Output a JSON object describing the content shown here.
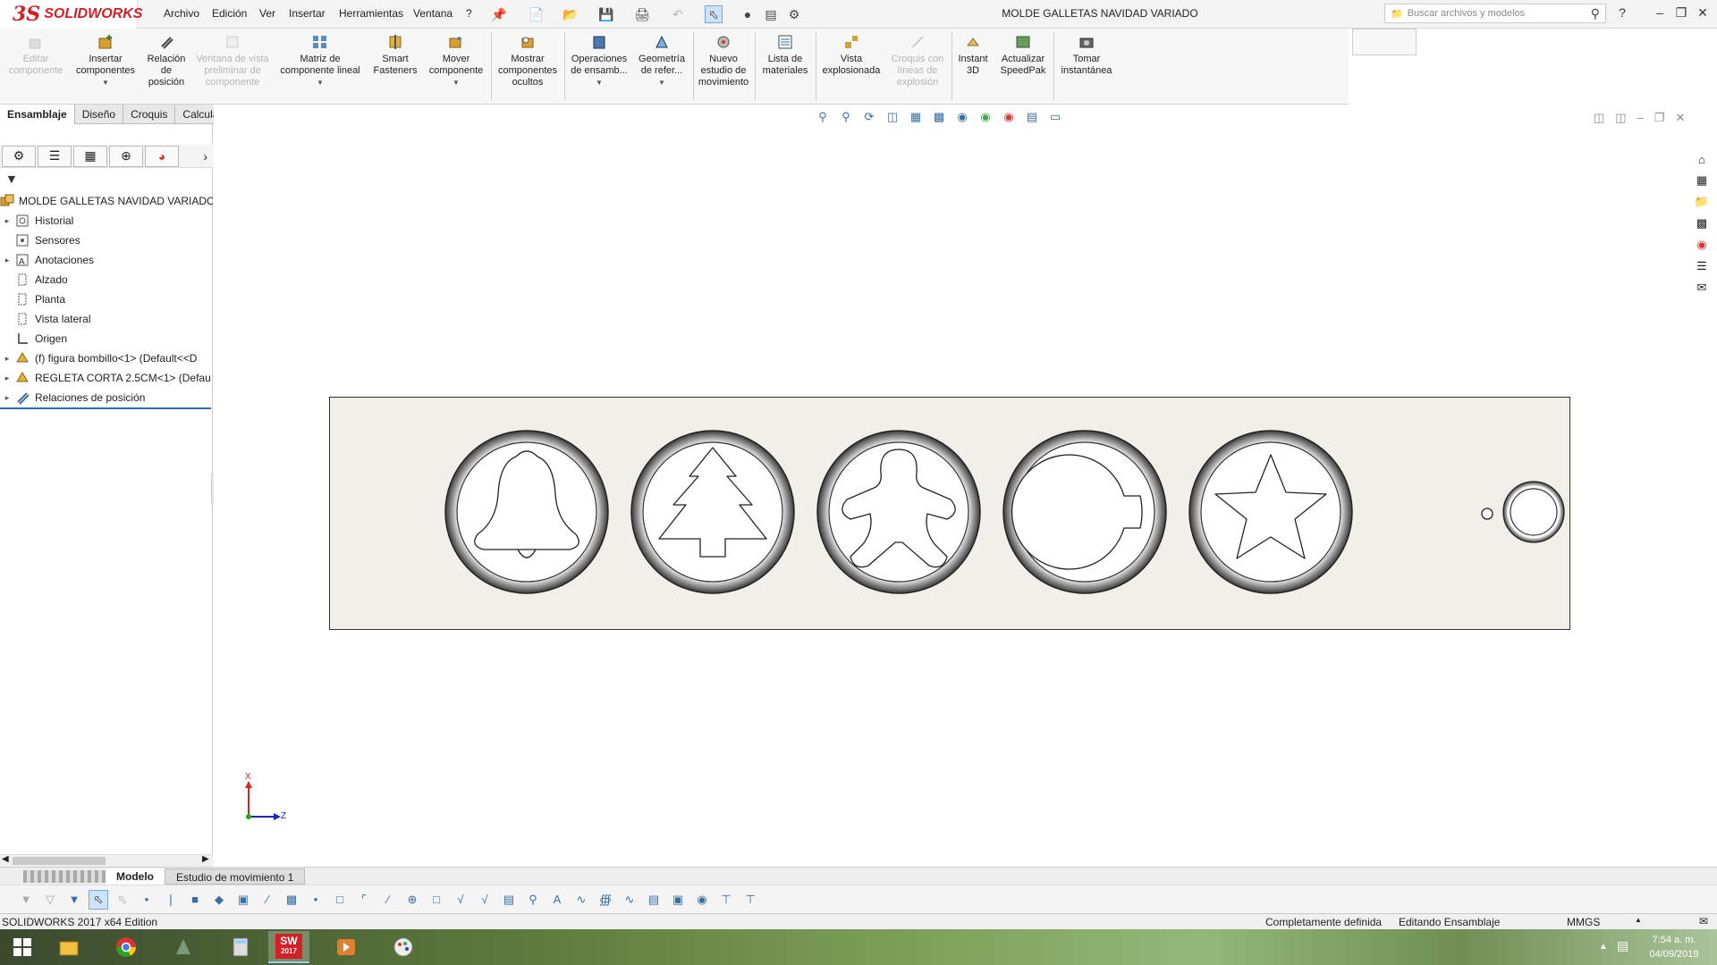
{
  "app": {
    "brand_prefix": "3S",
    "brand": "SOLIDWORKS"
  },
  "menu": [
    "Archivo",
    "Edición",
    "Ver",
    "Insertar",
    "Herramientas",
    "Ventana",
    "?"
  ],
  "document_title": "MOLDE GALLETAS NAVIDAD VARIADO",
  "search": {
    "placeholder": "Buscar archivos y modelos"
  },
  "commands": [
    {
      "label": "Editar\ncomponente",
      "enabled": false,
      "icon": "edit-component-icon"
    },
    {
      "label": "Insertar\ncomponentes",
      "enabled": true,
      "icon": "insert-components-icon"
    },
    {
      "label": "Relación\nde\nposición",
      "enabled": true,
      "icon": "mate-icon"
    },
    {
      "label": "Ventana de vista\npreliminar de\ncomponente",
      "enabled": false,
      "icon": "preview-window-icon"
    },
    {
      "label": "Matriz de\ncomponente lineal",
      "enabled": true,
      "icon": "linear-pattern-icon"
    },
    {
      "label": "Smart\nFasteners",
      "enabled": true,
      "icon": "smart-fasteners-icon"
    },
    {
      "label": "Mover\ncomponente",
      "enabled": true,
      "icon": "move-component-icon"
    },
    {
      "label": "Mostrar\ncomponentes\nocultos",
      "enabled": true,
      "icon": "show-hidden-icon"
    },
    {
      "label": "Operaciones\nde ensamb...",
      "enabled": true,
      "icon": "assembly-features-icon"
    },
    {
      "label": "Geometría\nde refer...",
      "enabled": true,
      "icon": "reference-geometry-icon"
    },
    {
      "label": "Nuevo\nestudio de\nmovimiento",
      "enabled": true,
      "icon": "motion-study-icon"
    },
    {
      "label": "Lista de\nmateriales",
      "enabled": true,
      "icon": "bom-icon"
    },
    {
      "label": "Vista\nexplosionada",
      "enabled": true,
      "icon": "exploded-view-icon"
    },
    {
      "label": "Croquis con\nlíneas de\nexplosión",
      "enabled": false,
      "icon": "explode-line-icon"
    },
    {
      "label": "Instant\n3D",
      "enabled": true,
      "icon": "instant3d-icon"
    },
    {
      "label": "Actualizar\nSpeedPak",
      "enabled": true,
      "icon": "speedpak-icon"
    },
    {
      "label": "Tomar\ninstantánea",
      "enabled": true,
      "icon": "snapshot-icon"
    }
  ],
  "tabs": [
    {
      "label": "Ensamblaje",
      "active": true
    },
    {
      "label": "Diseño",
      "active": false
    },
    {
      "label": "Croquis",
      "active": false
    },
    {
      "label": "Calcular",
      "active": false
    }
  ],
  "tree": {
    "root": "MOLDE GALLETAS NAVIDAD VARIADO",
    "items": [
      {
        "label": "Historial",
        "expandable": true,
        "icon": "history-icon"
      },
      {
        "label": "Sensores",
        "expandable": false,
        "icon": "sensors-icon"
      },
      {
        "label": "Anotaciones",
        "expandable": true,
        "icon": "annotations-icon"
      },
      {
        "label": "Alzado",
        "expandable": false,
        "icon": "plane-icon"
      },
      {
        "label": "Planta",
        "expandable": false,
        "icon": "plane-icon"
      },
      {
        "label": "Vista lateral",
        "expandable": false,
        "icon": "plane-icon"
      },
      {
        "label": "Origen",
        "expandable": false,
        "icon": "origin-icon"
      },
      {
        "label": "(f) figura bombillo<1> (Default<<D",
        "expandable": true,
        "icon": "part-icon"
      },
      {
        "label": "REGLETA CORTA 2.5CM<1> (Defau",
        "expandable": true,
        "icon": "part-icon"
      },
      {
        "label": "Relaciones de posición",
        "expandable": true,
        "icon": "mates-icon"
      }
    ]
  },
  "bottom_tabs": [
    {
      "label": "Modelo",
      "active": true
    },
    {
      "label": "Estudio de movimiento 1",
      "active": false
    }
  ],
  "status": {
    "edition": "SOLIDWORKS 2017 x64 Edition",
    "definition": "Completamente definida",
    "mode": "Editando Ensamblaje",
    "units": "MMGS"
  },
  "clock": {
    "time": "7:54 a. m.",
    "date": "04/09/2019"
  },
  "taskbar_labels": {
    "sw_badge": "2017"
  },
  "triad": {
    "x": "X",
    "z": "Z"
  },
  "colors": {
    "brand_red": "#d31f26",
    "plate": "#f1efea",
    "selection_blue": "#2a6fc0"
  }
}
